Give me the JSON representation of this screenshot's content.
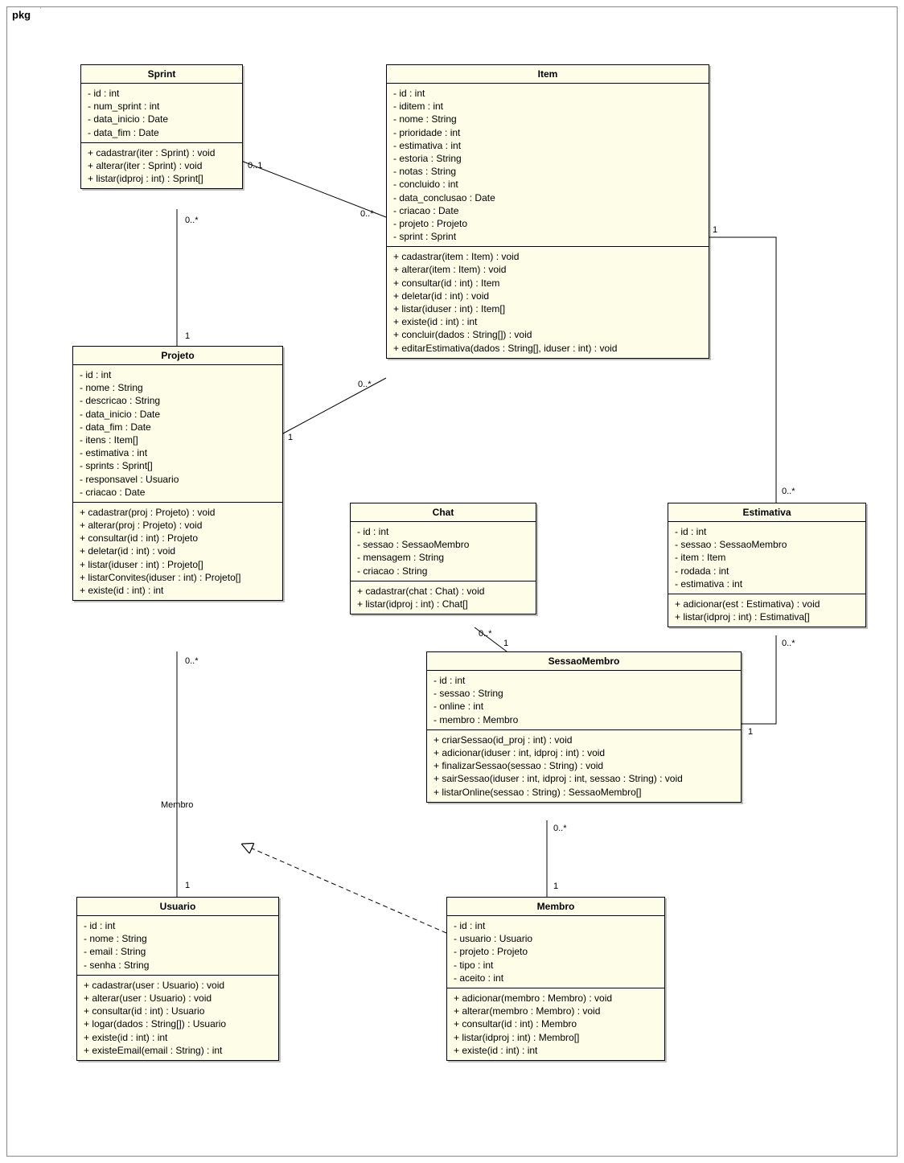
{
  "package_label": "pkg",
  "classes": {
    "sprint": {
      "name": "Sprint",
      "attrs": [
        "- id : int",
        "- num_sprint : int",
        "- data_inicio : Date",
        "- data_fim : Date"
      ],
      "ops": [
        "+ cadastrar(iter : Sprint) : void",
        "+ alterar(iter : Sprint) : void",
        "+ listar(idproj : int) : Sprint[]"
      ]
    },
    "item": {
      "name": "Item",
      "attrs": [
        "- id : int",
        "- iditem : int",
        "- nome : String",
        "- prioridade : int",
        "- estimativa : int",
        "- estoria : String",
        "- notas : String",
        "- concluido : int",
        "- data_conclusao : Date",
        "- criacao : Date",
        "- projeto : Projeto",
        "- sprint : Sprint"
      ],
      "ops": [
        "+ cadastrar(item : Item) : void",
        "+ alterar(item : Item) : void",
        "+ consultar(id : int) : Item",
        "+ deletar(id : int) : void",
        "+ listar(iduser : int) : Item[]",
        "+ existe(id : int) : int",
        "+ concluir(dados : String[]) : void",
        "+ editarEstimativa(dados : String[], iduser : int) : void"
      ]
    },
    "projeto": {
      "name": "Projeto",
      "attrs": [
        "- id : int",
        "- nome : String",
        "- descricao : String",
        "- data_inicio : Date",
        "- data_fim : Date",
        "- itens : Item[]",
        "- estimativa : int",
        "- sprints : Sprint[]",
        "- responsavel : Usuario",
        "- criacao : Date"
      ],
      "ops": [
        "+ cadastrar(proj : Projeto) : void",
        "+ alterar(proj : Projeto) : void",
        "+ consultar(id : int) : Projeto",
        "+ deletar(id : int) : void",
        "+ listar(iduser : int) : Projeto[]",
        "+ listarConvites(iduser : int) : Projeto[]",
        "+ existe(id : int) : int"
      ]
    },
    "chat": {
      "name": "Chat",
      "attrs": [
        "- id : int",
        "- sessao : SessaoMembro",
        "- mensagem : String",
        "- criacao : String"
      ],
      "ops": [
        "+ cadastrar(chat : Chat) : void",
        "+ listar(idproj : int) : Chat[]"
      ]
    },
    "estimativa": {
      "name": "Estimativa",
      "attrs": [
        "- id : int",
        "- sessao : SessaoMembro",
        "- item : Item",
        "- rodada : int",
        "- estimativa : int"
      ],
      "ops": [
        "+ adicionar(est : Estimativa) : void",
        "+ listar(idproj : int) : Estimativa[]"
      ]
    },
    "sessaomembro": {
      "name": "SessaoMembro",
      "attrs": [
        "- id : int",
        "- sessao : String",
        "- online : int",
        "- membro : Membro"
      ],
      "ops": [
        "+ criarSessao(id_proj : int) : void",
        "+ adicionar(iduser : int, idproj : int) : void",
        "+ finalizarSessao(sessao : String) : void",
        "+ sairSessao(iduser : int, idproj : int, sessao : String) : void",
        "+ listarOnline(sessao : String) : SessaoMembro[]"
      ]
    },
    "usuario": {
      "name": "Usuario",
      "attrs": [
        "- id : int",
        "- nome : String",
        "- email : String",
        "- senha : String"
      ],
      "ops": [
        "+ cadastrar(user : Usuario) : void",
        "+ alterar(user : Usuario) : void",
        "+ consultar(id : int) : Usuario",
        "+ logar(dados : String[]) : Usuario",
        "+ existe(id : int) : int",
        "+ existeEmail(email : String) : int"
      ]
    },
    "membro": {
      "name": "Membro",
      "attrs": [
        "- id : int",
        "- usuario : Usuario",
        "- projeto : Projeto",
        "- tipo : int",
        "- aceito : int"
      ],
      "ops": [
        "+ adicionar(membro : Membro) : void",
        "+ alterar(membro : Membro) : void",
        "+ consultar(id : int) : Membro",
        "+ listar(idproj : int) : Membro[]",
        "+ existe(id : int) : int"
      ]
    }
  },
  "labels": {
    "sprint_item_sprint": "0..1",
    "sprint_item_item": "0..*",
    "sprint_projeto_sprint": "0..*",
    "sprint_projeto_projeto": "1",
    "projeto_item_projeto": "1",
    "projeto_item_item": "0..*",
    "projeto_usuario_projeto": "0..*",
    "projeto_usuario_usuario": "1",
    "item_estimativa_item": "1",
    "item_estimativa_estimativa": "0..*",
    "chat_sessao_chat": "0..*",
    "chat_sessao_sessao": "1",
    "estimativa_sessao_estimativa": "0..*",
    "estimativa_sessao_sessao": "1",
    "sessao_membro_sessao": "0..*",
    "sessao_membro_membro": "1",
    "membro_role": "Membro"
  }
}
